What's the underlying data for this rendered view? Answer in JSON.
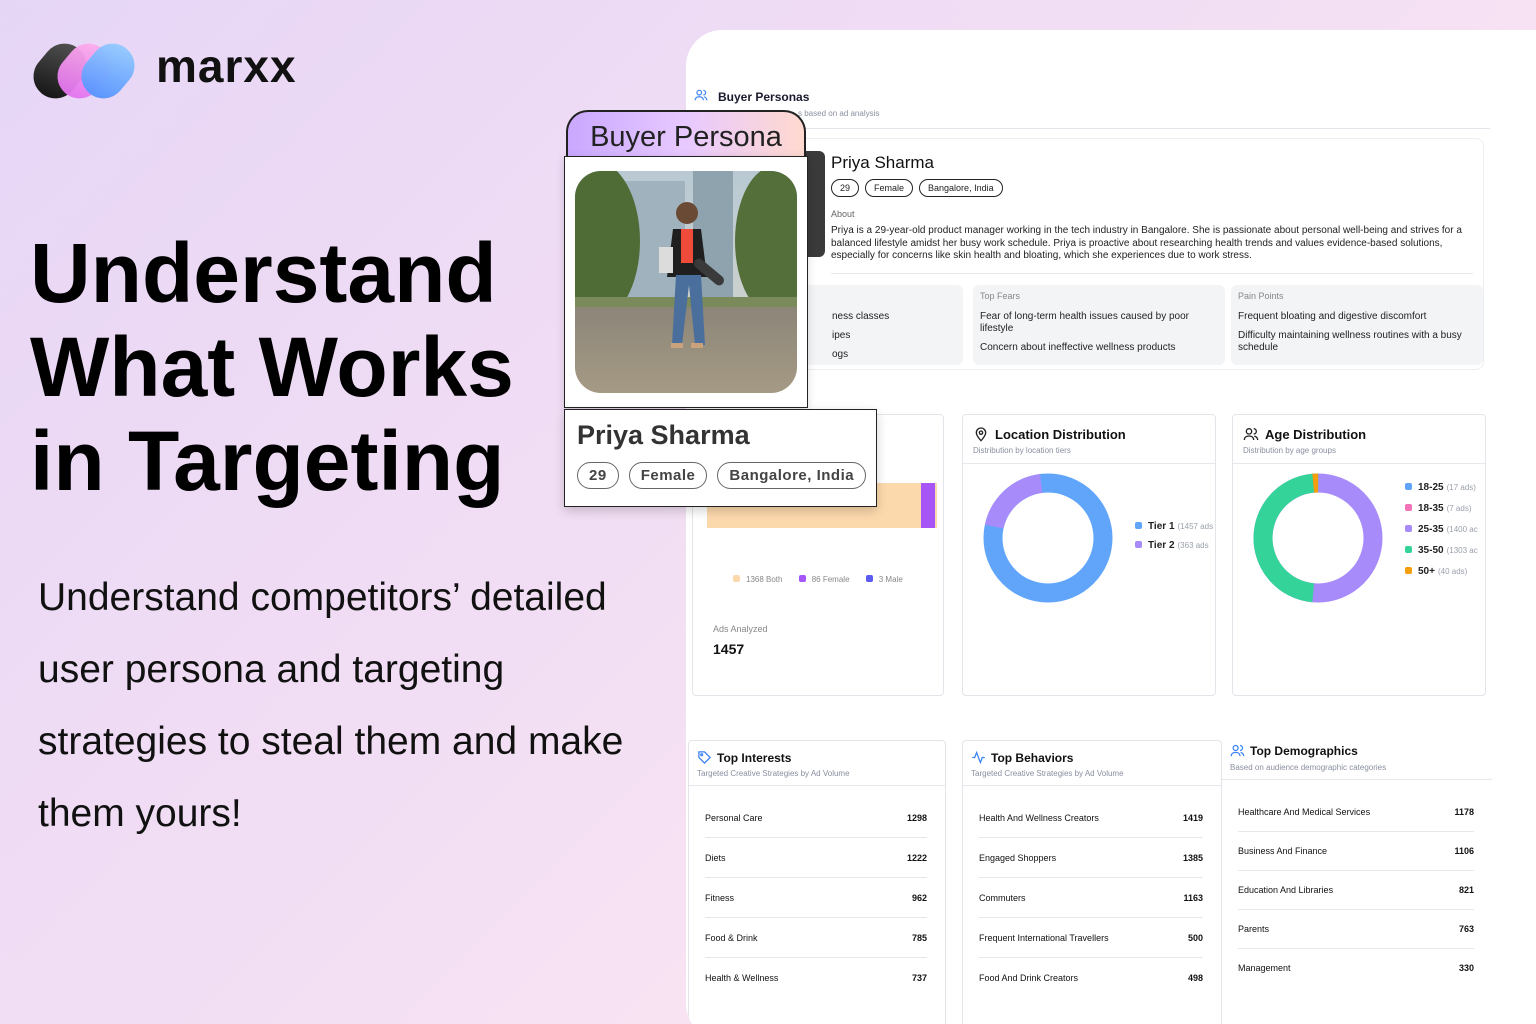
{
  "brand": {
    "name": "marxx"
  },
  "headline": [
    "Understand",
    "What Works",
    "in Targeting"
  ],
  "subcopy": [
    "Understand competitors’ detailed",
    "user persona and targeting",
    "strategies to steal them and make",
    "them yours!"
  ],
  "buyer_personas": {
    "title": "Buyer Personas",
    "subtitle": "s based on ad analysis",
    "persona": {
      "name": "Priya Sharma",
      "age": "29",
      "gender": "Female",
      "location": "Bangalore, India",
      "about_label": "About",
      "about": "Priya is a 29-year-old product manager working in the tech industry in Bangalore. She is passionate about personal well-being and strives for a balanced lifestyle amidst her busy work schedule. Priya is proactive about researching health trends and values evidence-based solutions, especially for concerns like skin health and bloating, which she experiences due to work stress.",
      "interests_partial": [
        "ness classes",
        "ipes",
        "ogs"
      ],
      "top_fears": {
        "label": "Top Fears",
        "items": [
          "Fear of long-term health issues caused by poor lifestyle",
          "Concern about ineffective wellness products"
        ]
      },
      "pain_points": {
        "label": "Pain Points",
        "items": [
          "Frequent bloating and digestive discomfort",
          "Difficulty maintaining wellness routines with a busy schedule"
        ]
      }
    }
  },
  "overlay": {
    "tab_label": "Buyer Persona",
    "name": "Priya Sharma",
    "age": "29",
    "gender": "Female",
    "location": "Bangalore, India"
  },
  "gender_card": {
    "legend": [
      {
        "label": "1368 Both",
        "color": "#fcd9ad"
      },
      {
        "label": "86 Female",
        "color": "#a855f7"
      },
      {
        "label": "3 Male",
        "color": "#5b5bf0"
      }
    ],
    "ads_label": "Ads Analyzed",
    "ads_value": "1457"
  },
  "location_card": {
    "title": "Location Distribution",
    "subtitle": "Distribution by location tiers",
    "legend": [
      {
        "label": "Tier 1",
        "count": "(1457 ads",
        "color": "#60a5fa"
      },
      {
        "label": "Tier 2",
        "count": "(363 ads",
        "color": "#a78bfa"
      }
    ]
  },
  "age_card": {
    "title": "Age Distribution",
    "subtitle": "Distribution by age groups",
    "legend": [
      {
        "label": "18-25",
        "count": "(17 ads)",
        "color": "#60a5fa"
      },
      {
        "label": "18-35",
        "count": "(7 ads)",
        "color": "#f472b6"
      },
      {
        "label": "25-35",
        "count": "(1400 ac",
        "color": "#a78bfa"
      },
      {
        "label": "35-50",
        "count": "(1303 ac",
        "color": "#34d399"
      },
      {
        "label": "50+",
        "count": "(40 ads)",
        "color": "#f59e0b"
      }
    ]
  },
  "interests_card": {
    "title": "Top Interests",
    "subtitle": "Targeted Creative Strategies by Ad Volume",
    "rows": [
      {
        "label": "Personal Care",
        "value": "1298"
      },
      {
        "label": "Diets",
        "value": "1222"
      },
      {
        "label": "Fitness",
        "value": "962"
      },
      {
        "label": "Food & Drink",
        "value": "785"
      },
      {
        "label": "Health & Wellness",
        "value": "737"
      }
    ]
  },
  "behaviors_card": {
    "title": "Top Behaviors",
    "subtitle": "Targeted Creative Strategies by Ad Volume",
    "rows": [
      {
        "label": "Health And Wellness Creators",
        "value": "1419"
      },
      {
        "label": "Engaged Shoppers",
        "value": "1385"
      },
      {
        "label": "Commuters",
        "value": "1163"
      },
      {
        "label": "Frequent International Travellers",
        "value": "500"
      },
      {
        "label": "Food And Drink Creators",
        "value": "498"
      }
    ]
  },
  "demographics_card": {
    "title": "Top Demographics",
    "subtitle": "Based on audience demographic categories",
    "rows": [
      {
        "label": "Healthcare And Medical Services",
        "value": "1178"
      },
      {
        "label": "Business And Finance",
        "value": "1106"
      },
      {
        "label": "Education And Libraries",
        "value": "821"
      },
      {
        "label": "Parents",
        "value": "763"
      },
      {
        "label": "Management",
        "value": "330"
      }
    ]
  }
}
